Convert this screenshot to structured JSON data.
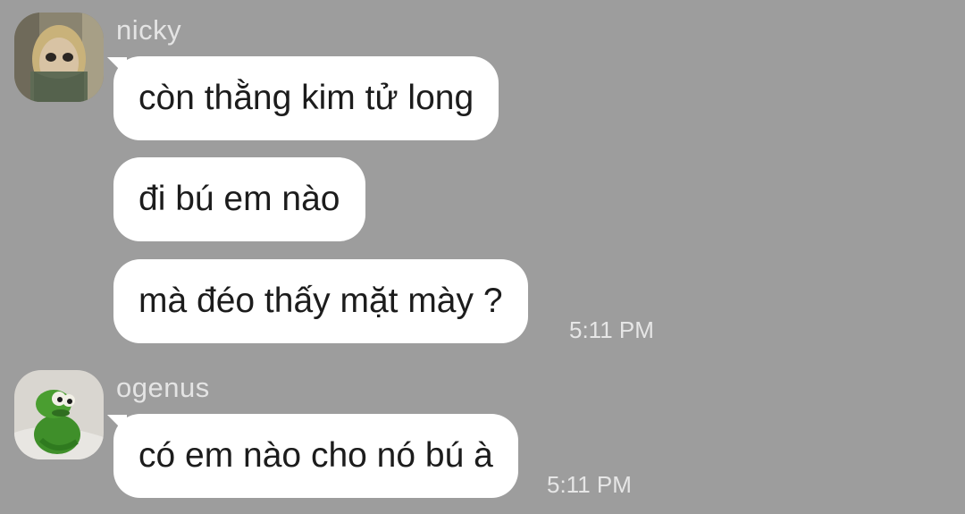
{
  "conversation": [
    {
      "sender": "nicky",
      "avatar_icon": "nicky-avatar-photo",
      "messages": [
        "còn thằng kim tử long",
        "đi bú em nào",
        "mà đéo thấy mặt mày ?"
      ],
      "time": "5:11 PM"
    },
    {
      "sender": "ogenus",
      "avatar_icon": "kermit-frog-avatar",
      "messages": [
        "có em nào cho nó bú à"
      ],
      "time": "5:11 PM"
    }
  ],
  "colors": {
    "background": "#9d9d9d",
    "bubble": "#ffffff",
    "message_text": "#1c1c1c",
    "meta_text": "#e4e4e4"
  }
}
